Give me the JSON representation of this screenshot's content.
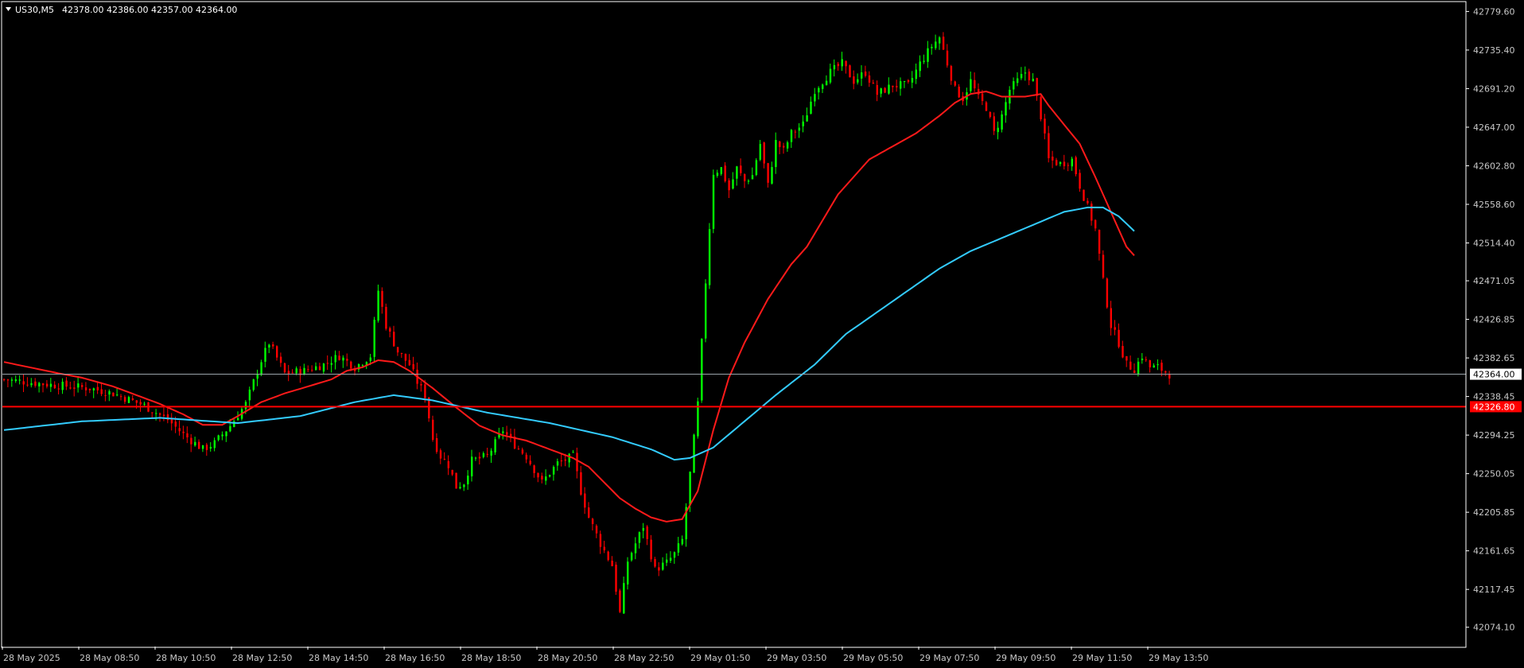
{
  "chart_header": {
    "symbol_timeframe": "US30,M5",
    "ohlc": "42378.00 42386.00 42357.00 42364.00"
  },
  "colors": {
    "background": "#000000",
    "frame": "#ffffff",
    "candle_up": "#00ff00",
    "candle_down": "#ff0000",
    "ma_fast": "#ff1a1a",
    "ma_slow": "#33ccff",
    "bid_line": "#9aa3aa",
    "level_line": "#ff0000"
  },
  "chart_data": {
    "type": "line",
    "ylim": [
      42052.0,
      42790.0
    ],
    "y_ticks": [
      "42779.60",
      "42735.40",
      "42691.20",
      "42647.00",
      "42602.80",
      "42558.60",
      "42514.40",
      "42471.05",
      "42426.85",
      "42382.65",
      "42338.45",
      "42294.25",
      "42250.05",
      "42205.85",
      "42161.65",
      "42117.45",
      "42074.10"
    ],
    "x_ticks": [
      "28 May 2025",
      "28 May 08:50",
      "28 May 10:50",
      "28 May 12:50",
      "28 May 14:50",
      "28 May 16:50",
      "28 May 18:50",
      "28 May 20:50",
      "28 May 22:50",
      "29 May 01:50",
      "29 May 03:50",
      "29 May 05:50",
      "29 May 07:50",
      "29 May 09:50",
      "29 May 11:50",
      "29 May 13:50"
    ],
    "bar_count": 300,
    "price_anchors": [
      [
        0,
        42358
      ],
      [
        12,
        42352
      ],
      [
        22,
        42348
      ],
      [
        28,
        42342
      ],
      [
        36,
        42328
      ],
      [
        42,
        42312
      ],
      [
        46,
        42295
      ],
      [
        51,
        42278
      ],
      [
        54,
        42285
      ],
      [
        58,
        42305
      ],
      [
        62,
        42330
      ],
      [
        66,
        42380
      ],
      [
        68,
        42400
      ],
      [
        72,
        42365
      ],
      [
        77,
        42368
      ],
      [
        82,
        42375
      ],
      [
        86,
        42385
      ],
      [
        90,
        42372
      ],
      [
        94,
        42385
      ],
      [
        96,
        42460
      ],
      [
        98,
        42420
      ],
      [
        101,
        42390
      ],
      [
        104,
        42375
      ],
      [
        106,
        42355
      ],
      [
        108,
        42340
      ],
      [
        110,
        42290
      ],
      [
        112,
        42270
      ],
      [
        114,
        42260
      ],
      [
        116,
        42235
      ],
      [
        118,
        42240
      ],
      [
        120,
        42265
      ],
      [
        124,
        42270
      ],
      [
        128,
        42300
      ],
      [
        130,
        42288
      ],
      [
        134,
        42270
      ],
      [
        138,
        42240
      ],
      [
        142,
        42262
      ],
      [
        146,
        42270
      ],
      [
        148,
        42230
      ],
      [
        150,
        42200
      ],
      [
        153,
        42170
      ],
      [
        156,
        42145
      ],
      [
        158,
        42090
      ],
      [
        160,
        42150
      ],
      [
        164,
        42190
      ],
      [
        167,
        42140
      ],
      [
        170,
        42148
      ],
      [
        172,
        42158
      ],
      [
        174,
        42174
      ],
      [
        176,
        42250
      ],
      [
        178,
        42330
      ],
      [
        180,
        42470
      ],
      [
        182,
        42595
      ],
      [
        184,
        42600
      ],
      [
        186,
        42575
      ],
      [
        188,
        42600
      ],
      [
        190,
        42585
      ],
      [
        192,
        42592
      ],
      [
        194,
        42628
      ],
      [
        196,
        42580
      ],
      [
        198,
        42630
      ],
      [
        200,
        42620
      ],
      [
        202,
        42640
      ],
      [
        205,
        42650
      ],
      [
        208,
        42690
      ],
      [
        212,
        42710
      ],
      [
        215,
        42720
      ],
      [
        218,
        42700
      ],
      [
        221,
        42710
      ],
      [
        224,
        42685
      ],
      [
        228,
        42695
      ],
      [
        232,
        42695
      ],
      [
        235,
        42720
      ],
      [
        238,
        42740
      ],
      [
        240,
        42750
      ],
      [
        242,
        42720
      ],
      [
        244,
        42690
      ],
      [
        246,
        42680
      ],
      [
        248,
        42700
      ],
      [
        250,
        42680
      ],
      [
        252,
        42670
      ],
      [
        254,
        42640
      ],
      [
        256,
        42660
      ],
      [
        258,
        42690
      ],
      [
        260,
        42700
      ],
      [
        262,
        42710
      ],
      [
        264,
        42700
      ],
      [
        266,
        42660
      ],
      [
        268,
        42610
      ],
      [
        271,
        42605
      ],
      [
        274,
        42610
      ],
      [
        276,
        42580
      ],
      [
        278,
        42555
      ],
      [
        280,
        42530
      ],
      [
        282,
        42470
      ],
      [
        284,
        42420
      ],
      [
        286,
        42400
      ],
      [
        288,
        42375
      ],
      [
        290,
        42370
      ],
      [
        292,
        42385
      ],
      [
        294,
        42372
      ],
      [
        296,
        42372
      ],
      [
        299,
        42364
      ]
    ],
    "series": [
      {
        "points": [
          [
            0,
            42378
          ],
          [
            14,
            42365
          ],
          [
            20,
            42360
          ],
          [
            28,
            42350
          ],
          [
            34,
            42340
          ],
          [
            40,
            42330
          ],
          [
            46,
            42318
          ],
          [
            51,
            42306
          ],
          [
            56,
            42306
          ],
          [
            60,
            42316
          ],
          [
            66,
            42332
          ],
          [
            72,
            42342
          ],
          [
            78,
            42350
          ],
          [
            84,
            42358
          ],
          [
            88,
            42368
          ],
          [
            92,
            42372
          ],
          [
            96,
            42380
          ],
          [
            100,
            42378
          ],
          [
            104,
            42368
          ],
          [
            110,
            42348
          ],
          [
            116,
            42326
          ],
          [
            122,
            42305
          ],
          [
            128,
            42294
          ],
          [
            134,
            42288
          ],
          [
            140,
            42278
          ],
          [
            146,
            42268
          ],
          [
            150,
            42258
          ],
          [
            154,
            42240
          ],
          [
            158,
            42222
          ],
          [
            162,
            42210
          ],
          [
            166,
            42200
          ],
          [
            170,
            42195
          ],
          [
            174,
            42198
          ],
          [
            178,
            42230
          ],
          [
            182,
            42300
          ],
          [
            186,
            42360
          ],
          [
            190,
            42400
          ],
          [
            196,
            42450
          ],
          [
            202,
            42490
          ],
          [
            206,
            42510
          ],
          [
            210,
            42540
          ],
          [
            214,
            42570
          ],
          [
            218,
            42590
          ],
          [
            222,
            42610
          ],
          [
            228,
            42625
          ],
          [
            234,
            42640
          ],
          [
            240,
            42660
          ],
          [
            244,
            42675
          ],
          [
            248,
            42685
          ],
          [
            252,
            42688
          ],
          [
            256,
            42682
          ],
          [
            262,
            42682
          ],
          [
            266,
            42685
          ],
          [
            268,
            42672
          ],
          [
            272,
            42650
          ],
          [
            276,
            42628
          ],
          [
            280,
            42590
          ],
          [
            284,
            42550
          ],
          [
            288,
            42510
          ],
          [
            290,
            42500
          ]
        ]
      },
      {
        "points": [
          [
            0,
            42300
          ],
          [
            20,
            42310
          ],
          [
            40,
            42314
          ],
          [
            60,
            42308
          ],
          [
            76,
            42316
          ],
          [
            90,
            42332
          ],
          [
            100,
            42340
          ],
          [
            110,
            42334
          ],
          [
            124,
            42320
          ],
          [
            140,
            42308
          ],
          [
            156,
            42292
          ],
          [
            166,
            42278
          ],
          [
            172,
            42266
          ],
          [
            176,
            42268
          ],
          [
            182,
            42280
          ],
          [
            190,
            42310
          ],
          [
            198,
            42340
          ],
          [
            208,
            42375
          ],
          [
            216,
            42410
          ],
          [
            224,
            42435
          ],
          [
            232,
            42460
          ],
          [
            240,
            42485
          ],
          [
            248,
            42505
          ],
          [
            256,
            42520
          ],
          [
            264,
            42535
          ],
          [
            272,
            42550
          ],
          [
            278,
            42555
          ],
          [
            282,
            42555
          ],
          [
            286,
            42545
          ],
          [
            290,
            42528
          ]
        ]
      }
    ],
    "bid_price": "42364.00",
    "level_price": "42326.80"
  }
}
